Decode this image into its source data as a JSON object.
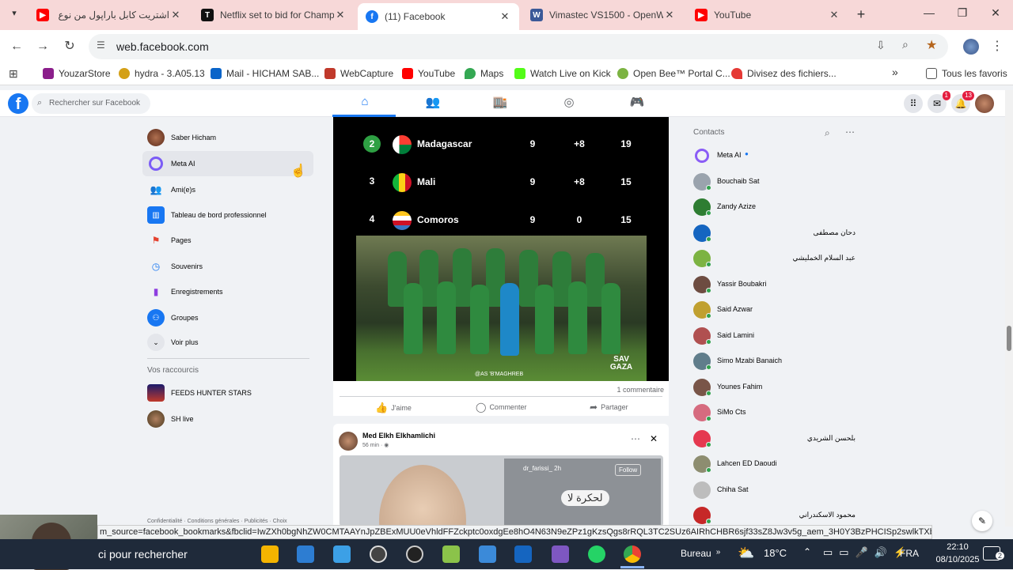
{
  "browser": {
    "tabs": [
      {
        "title": "اشتريت كابل باراپول من نوع أ",
        "icon": "youtube-icon",
        "color": "#ff0000",
        "close": "✕"
      },
      {
        "title": "Netflix set to bid for Champi",
        "icon": "tnt-icon",
        "color": "#111111",
        "close": "✕"
      },
      {
        "title": "(11) Facebook",
        "icon": "facebook-icon",
        "color": "#1877f2",
        "close": "✕"
      },
      {
        "title": "Vimastec VS1500 - OpenWe",
        "icon": "openweb-icon",
        "color": "#3b5998",
        "close": "✕"
      },
      {
        "title": "YouTube",
        "icon": "youtube-icon",
        "color": "#ff0000",
        "close": "✕"
      }
    ],
    "new_tab": "+",
    "url": "web.facebook.com",
    "bookmarks": [
      {
        "label": "YouzarStore",
        "color": "#8b1e8b"
      },
      {
        "label": "hydra - 3.A05.13",
        "color": "#d4a017"
      },
      {
        "label": "Mail - HICHAM SAB...",
        "color": "#0a64c9"
      },
      {
        "label": "WebCapture",
        "color": "#c0392b"
      },
      {
        "label": "YouTube",
        "color": "#ff0000"
      },
      {
        "label": "Maps",
        "color": "#34a853"
      },
      {
        "label": "Watch Live on Kick",
        "color": "#53fc18"
      },
      {
        "label": "Open Bee™ Portal C...",
        "color": "#7cb342"
      },
      {
        "label": "Divisez des fichiers...",
        "color": "#e53935"
      }
    ],
    "bookmarks_more": "»",
    "all_bookmarks": "Tous les favoris"
  },
  "facebook": {
    "logo": "f",
    "search_placeholder": "Rechercher sur Facebook",
    "badges": {
      "messenger": "1",
      "notifications": "13"
    },
    "left_menu": [
      {
        "label": "Saber Hicham",
        "icon": "profile-avatar"
      },
      {
        "label": "Meta AI",
        "icon": "meta-ai-icon"
      },
      {
        "label": "Ami(e)s",
        "icon": "friends-icon"
      },
      {
        "label": "Tableau de bord professionnel",
        "icon": "dashboard-icon"
      },
      {
        "label": "Pages",
        "icon": "pages-flag-icon"
      },
      {
        "label": "Souvenirs",
        "icon": "memories-clock-icon"
      },
      {
        "label": "Enregistrements",
        "icon": "bookmark-icon"
      },
      {
        "label": "Groupes",
        "icon": "groups-icon"
      },
      {
        "label": "Voir plus",
        "icon": "chevron-down-icon"
      }
    ],
    "shortcuts_title": "Vos raccourcis",
    "shortcuts": [
      {
        "label": "FEEDS HUNTER STARS"
      },
      {
        "label": "SH live"
      }
    ],
    "footer_links": "Confidentialité · Conditions générales · Publicités · Choix",
    "post1": {
      "standings": [
        {
          "rank": "2",
          "team": "Madagascar",
          "played": "9",
          "gd": "+8",
          "pts": "19"
        },
        {
          "rank": "3",
          "team": "Mali",
          "played": "9",
          "gd": "+8",
          "pts": "15"
        },
        {
          "rank": "4",
          "team": "Comoros",
          "played": "9",
          "gd": "0",
          "pts": "15"
        }
      ],
      "watermark": "SAV GAZA",
      "credit": "@AS 'B'MAGHREB",
      "comments": "1 commentaire",
      "like": "J'aime",
      "comment": "Commenter",
      "share": "Partager"
    },
    "post2": {
      "author": "Med Elkh Elkhamlichi",
      "time": "56 min · ",
      "overlay_user": "dr_farissi_ 2h",
      "follow": "Follow",
      "caption": "لحكرة لا"
    },
    "contacts_title": "Contacts",
    "contacts": [
      {
        "name": "Meta AI",
        "rtl": false,
        "color": "#8a5cf6",
        "online": false
      },
      {
        "name": "Bouchaib Sat",
        "rtl": false,
        "color": "#9aa3ad",
        "online": true
      },
      {
        "name": "Zandy Azize",
        "rtl": false,
        "color": "#2e7d32",
        "online": true
      },
      {
        "name": "دحان مصطفى",
        "rtl": true,
        "color": "#1565c0",
        "online": true
      },
      {
        "name": "عبد السلام الخمليشي",
        "rtl": true,
        "color": "#7cb342",
        "online": true
      },
      {
        "name": "Yassir Boubakri",
        "rtl": false,
        "color": "#6d4c41",
        "online": true
      },
      {
        "name": "Said Azwar",
        "rtl": false,
        "color": "#c0a030",
        "online": true
      },
      {
        "name": "Said Lamini",
        "rtl": false,
        "color": "#b05050",
        "online": true
      },
      {
        "name": "Simo Mzabi Banaich",
        "rtl": false,
        "color": "#607d8b",
        "online": true
      },
      {
        "name": "Younes Fahim",
        "rtl": false,
        "color": "#795548",
        "online": true
      },
      {
        "name": "SiMo Cts",
        "rtl": false,
        "color": "#d66b7f",
        "online": true
      },
      {
        "name": "بلحسن الشريدي",
        "rtl": true,
        "color": "#e53950",
        "online": true
      },
      {
        "name": "Lahcen ED Daoudi",
        "rtl": false,
        "color": "#8d8d70",
        "online": true
      },
      {
        "name": "Chiha Sat",
        "rtl": false,
        "color": "#bdbdbd",
        "online": false
      },
      {
        "name": "محمود الاسكندراني",
        "rtl": true,
        "color": "#c62828",
        "online": true
      }
    ]
  },
  "status_url": "m_source=facebook_bookmarks&fbclid=IwZXh0bgNhZW0CMTAAYnJpZBExMUU0eVhldFFZckptc0oxdgEe8hO4N63N9eZPz1gKzsQgs8rRQL3TC2SUz6AIRhCHBR6sjf33sZ8Jw3v5g_aem_3H0Y3BzPHCISp2swlkTXbA",
  "taskbar": {
    "search": "ci pour rechercher",
    "bureau": "Bureau",
    "weather": "18°C",
    "language": "FRA",
    "time": "22:10",
    "date": "08/10/2025",
    "notif_count": "2"
  }
}
